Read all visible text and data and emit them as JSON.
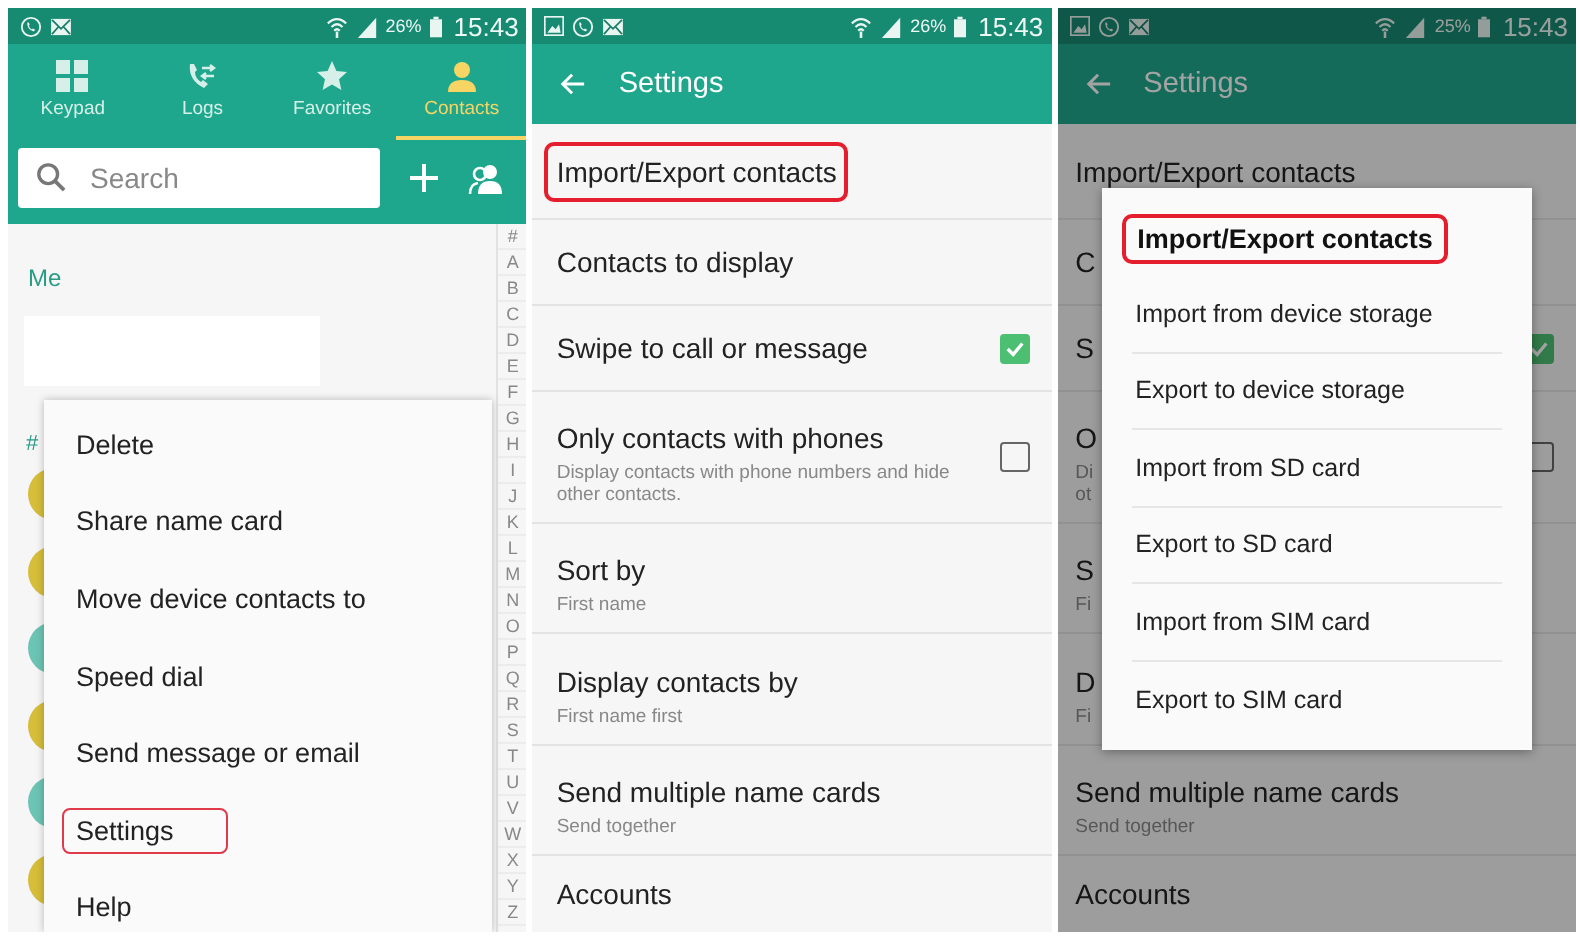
{
  "panels": [
    {
      "kind": "contacts",
      "dimmed": false,
      "status_bar": {
        "notifications": [
          {
            "kind": "call"
          },
          {
            "kind": "mail"
          }
        ],
        "battery": "26%",
        "time": "15:43"
      },
      "tabs": [
        {
          "label": "Keypad",
          "selected": false
        },
        {
          "label": "Logs",
          "selected": false
        },
        {
          "label": "Favorites",
          "selected": false
        },
        {
          "label": "Contacts",
          "selected": true
        }
      ],
      "search": {
        "placeholder": "Search"
      },
      "section_label": "Me",
      "group_label": "#",
      "avatars": [
        {
          "color": "#d6bd3a"
        },
        {
          "color": "#d6bd3a"
        },
        {
          "color": "#6cc4b4"
        },
        {
          "color": "#d6bd3a"
        },
        {
          "color": "#6cc4b4"
        },
        {
          "color": "#d6bd3a"
        }
      ],
      "index": [
        "#",
        "A",
        "B",
        "C",
        "D",
        "E",
        "F",
        "G",
        "H",
        "I",
        "J",
        "K",
        "L",
        "M",
        "N",
        "O",
        "P",
        "Q",
        "R",
        "S",
        "T",
        "U",
        "V",
        "W",
        "X",
        "Y",
        "Z"
      ],
      "menu": [
        {
          "label": "Delete",
          "highlighted": false
        },
        {
          "label": "Share name card",
          "highlighted": false
        },
        {
          "label": "Move device contacts to",
          "highlighted": false
        },
        {
          "label": "Speed dial",
          "highlighted": false
        },
        {
          "label": "Send message or email",
          "highlighted": false
        },
        {
          "label": "Settings",
          "highlighted": true
        },
        {
          "label": "Help",
          "highlighted": false
        }
      ]
    },
    {
      "kind": "settings",
      "dimmed": false,
      "status_bar": {
        "notifications": [
          {
            "kind": "image"
          },
          {
            "kind": "call"
          },
          {
            "kind": "mail"
          }
        ],
        "battery": "26%",
        "time": "15:43"
      },
      "title": "Settings",
      "rows": [
        {
          "title": "Import/Export contacts",
          "highlighted": true
        },
        {
          "title": "Contacts to display",
          "highlighted": false
        },
        {
          "title": "Swipe to call or message",
          "checked": true,
          "highlighted": false
        },
        {
          "title": "Only contacts with phones",
          "subtitle": "Display contacts with phone numbers and hide other contacts.",
          "checked": false,
          "highlighted": false
        },
        {
          "title": "Sort by",
          "subtitle": "First name",
          "highlighted": false
        },
        {
          "title": "Display contacts by",
          "subtitle": "First name first",
          "highlighted": false
        },
        {
          "title": "Send multiple name cards",
          "subtitle": "Send together",
          "highlighted": false
        },
        {
          "title": "Accounts",
          "highlighted": false
        }
      ]
    },
    {
      "kind": "settings",
      "dimmed": true,
      "status_bar": {
        "notifications": [
          {
            "kind": "image"
          },
          {
            "kind": "call"
          },
          {
            "kind": "mail"
          }
        ],
        "battery": "25%",
        "time": "15:43"
      },
      "title": "Settings",
      "rows": [
        {
          "title": "Import/Export contacts",
          "highlighted": false
        },
        {
          "title": "C",
          "highlighted": false
        },
        {
          "title": "S",
          "checked": true,
          "highlighted": false
        },
        {
          "title": "O",
          "subtitle": "Di\not",
          "checked": false,
          "highlighted": false
        },
        {
          "title": "S",
          "subtitle": "Fi",
          "highlighted": false
        },
        {
          "title": "D",
          "subtitle": "Fi",
          "highlighted": false
        },
        {
          "title": "Send multiple name cards",
          "subtitle": "Send together",
          "highlighted": false
        },
        {
          "title": "Accounts",
          "highlighted": false
        }
      ],
      "dialog": {
        "title": "Import/Export contacts",
        "highlighted": true,
        "options": [
          "Import from device storage",
          "Export to device storage",
          "Import from SD card",
          "Export to SD card",
          "Import from SIM card",
          "Export to SIM card"
        ]
      }
    }
  ]
}
